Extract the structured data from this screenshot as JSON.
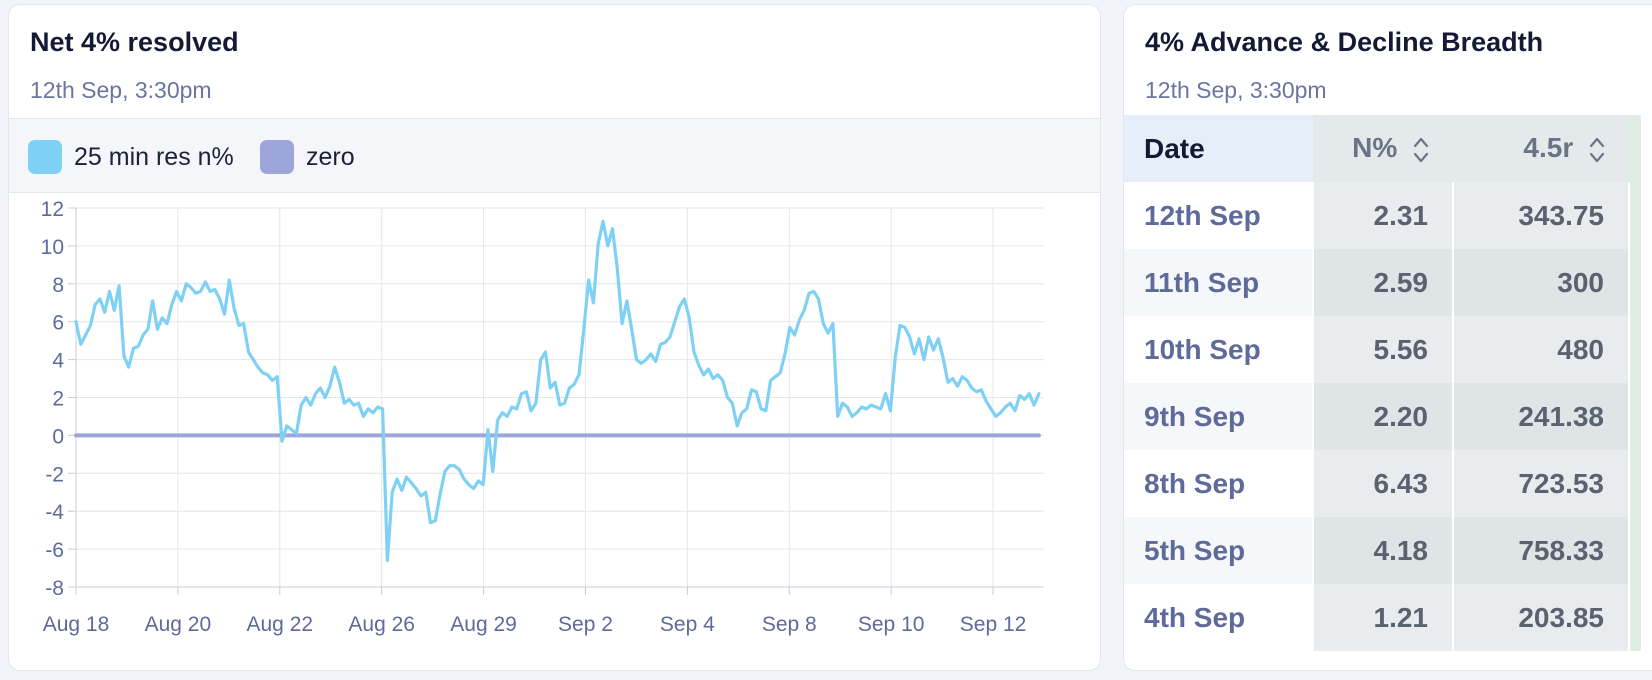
{
  "chart_card": {
    "title": "Net 4% resolved",
    "subtitle": "12th Sep, 3:30pm",
    "legend": [
      {
        "label": "25 min res n%",
        "color": "#7fd0f5"
      },
      {
        "label": "zero",
        "color": "#9da6da"
      }
    ]
  },
  "chart_data": {
    "type": "line",
    "title": "Net 4% resolved",
    "ylim": [
      -8,
      12
    ],
    "yticks": [
      "12",
      "10",
      "8",
      "6",
      "4",
      "2",
      "0",
      "-2",
      "-4",
      "-6",
      "-8"
    ],
    "xticks": [
      "Aug 18",
      "Aug 20",
      "Aug 22",
      "Aug 26",
      "Aug 29",
      "Sep 2",
      "Sep 4",
      "Sep 8",
      "Sep 10",
      "Sep 12"
    ],
    "grid": true,
    "series": [
      {
        "name": "25 min res n%",
        "color": "#7fd0f5",
        "x_start": 0,
        "x_end": 9.45,
        "values": [
          6.0,
          4.8,
          5.3,
          5.8,
          6.9,
          7.2,
          6.5,
          7.6,
          6.6,
          7.9,
          4.2,
          3.6,
          4.6,
          4.7,
          5.3,
          5.6,
          7.1,
          5.6,
          6.2,
          5.9,
          6.9,
          7.6,
          7.1,
          8.0,
          7.8,
          7.5,
          7.6,
          8.1,
          7.6,
          7.7,
          7.2,
          6.4,
          8.2,
          6.7,
          5.8,
          5.9,
          4.4,
          4.0,
          3.6,
          3.3,
          3.2,
          2.9,
          3.1,
          -0.3,
          0.5,
          0.3,
          0.1,
          1.6,
          2.0,
          1.6,
          2.2,
          2.5,
          2.0,
          2.6,
          3.6,
          2.8,
          1.7,
          1.9,
          1.6,
          1.7,
          1.0,
          1.4,
          1.2,
          1.5,
          1.4,
          -6.6,
          -3.0,
          -2.3,
          -2.9,
          -2.2,
          -2.5,
          -2.8,
          -3.2,
          -3.0,
          -4.6,
          -4.5,
          -3.1,
          -1.9,
          -1.6,
          -1.6,
          -1.8,
          -2.3,
          -2.6,
          -2.8,
          -2.4,
          -2.6,
          0.3,
          -1.9,
          0.8,
          1.2,
          1.0,
          1.5,
          1.4,
          2.2,
          2.3,
          1.3,
          1.7,
          4.0,
          4.4,
          2.5,
          2.8,
          1.6,
          1.7,
          2.5,
          2.7,
          3.2,
          5.6,
          8.2,
          7.0,
          10.1,
          11.3,
          10.0,
          10.9,
          8.8,
          5.9,
          7.1,
          5.6,
          4.0,
          3.8,
          4.0,
          4.3,
          3.9,
          4.8,
          4.9,
          5.2,
          6.0,
          6.8,
          7.2,
          6.2,
          4.4,
          3.7,
          3.2,
          3.5,
          3.0,
          3.2,
          2.9,
          2.0,
          1.7,
          0.5,
          1.2,
          1.4,
          2.4,
          2.3,
          1.4,
          1.3,
          2.9,
          3.1,
          3.3,
          4.3,
          5.7,
          5.3,
          6.1,
          6.6,
          7.5,
          7.6,
          7.2,
          5.9,
          5.4,
          5.9,
          1.0,
          1.7,
          1.5,
          1.0,
          1.2,
          1.5,
          1.4,
          1.6,
          1.5,
          1.4,
          2.2,
          1.3,
          4.1,
          5.8,
          5.7,
          5.2,
          4.3,
          5.1,
          4.0,
          5.2,
          4.5,
          5.1,
          4.1,
          2.8,
          3.0,
          2.6,
          3.1,
          2.9,
          2.5,
          2.3,
          2.4,
          1.8,
          1.4,
          1.0,
          1.2,
          1.5,
          1.7,
          1.3,
          2.1,
          1.9,
          2.2,
          1.6,
          2.2
        ]
      },
      {
        "name": "zero",
        "color": "#9da6da",
        "x_start": 0,
        "x_end": 9.45,
        "values": [
          0,
          0
        ]
      }
    ]
  },
  "table_card": {
    "title": "4% Advance & Decline Breadth",
    "subtitle": "12th Sep, 3:30pm",
    "columns": [
      {
        "label": "Date",
        "sortable": false
      },
      {
        "label": "N%",
        "sortable": true
      },
      {
        "label": "4.5r",
        "sortable": true
      }
    ],
    "rows": [
      {
        "date": "12th Sep",
        "n_pct": "2.31",
        "r45": "343.75"
      },
      {
        "date": "11th Sep",
        "n_pct": "2.59",
        "r45": "300"
      },
      {
        "date": "10th Sep",
        "n_pct": "5.56",
        "r45": "480"
      },
      {
        "date": "9th Sep",
        "n_pct": "2.20",
        "r45": "241.38"
      },
      {
        "date": "8th Sep",
        "n_pct": "6.43",
        "r45": "723.53"
      },
      {
        "date": "5th Sep",
        "n_pct": "4.18",
        "r45": "758.33"
      },
      {
        "date": "4th Sep",
        "n_pct": "1.21",
        "r45": "203.85"
      }
    ]
  }
}
